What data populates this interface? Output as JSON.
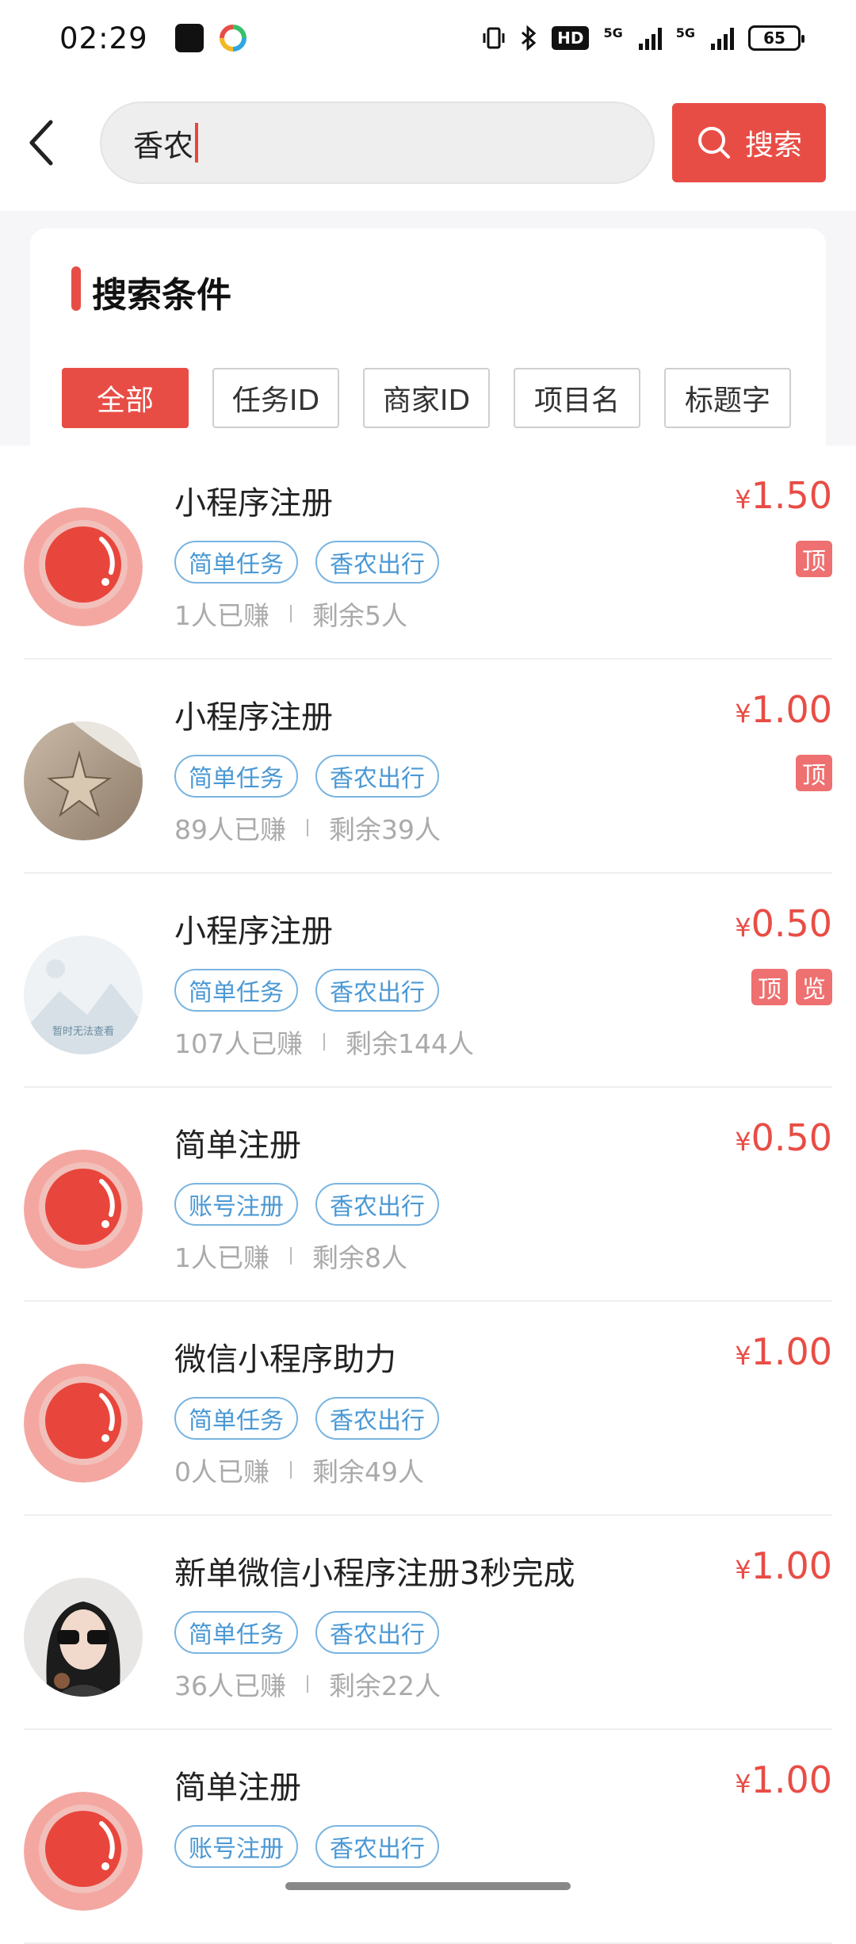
{
  "status": {
    "time": "02:29",
    "battery": "65",
    "net1": "5G",
    "net2": "5G",
    "hd": "HD"
  },
  "search": {
    "value": "香农",
    "button_label": "搜索"
  },
  "conditions": {
    "title": "搜索条件",
    "filters": [
      "全部",
      "任务ID",
      "商家ID",
      "项目名",
      "标题字"
    ],
    "active_index": 0
  },
  "colors": {
    "accent": "#e84d45",
    "tag_blue": "#4a98d4",
    "badge": "#ee7070"
  },
  "tasks": [
    {
      "title": "小程序注册",
      "tags": [
        "简单任务",
        "香农出行"
      ],
      "earned": "1人已赚",
      "remaining": "剩余5人",
      "price": "1.50",
      "currency": "¥",
      "badges": [
        "顶"
      ],
      "avatar": "red-camera-icon"
    },
    {
      "title": "小程序注册",
      "tags": [
        "简单任务",
        "香农出行"
      ],
      "earned": "89人已赚",
      "remaining": "剩余39人",
      "price": "1.00",
      "currency": "¥",
      "badges": [
        "顶"
      ],
      "avatar": "starfish-photo"
    },
    {
      "title": "小程序注册",
      "tags": [
        "简单任务",
        "香农出行"
      ],
      "earned": "107人已赚",
      "remaining": "剩余144人",
      "price": "0.50",
      "currency": "¥",
      "badges": [
        "顶",
        "览"
      ],
      "avatar": "image-unavailable",
      "avatar_text": "暂时无法查看"
    },
    {
      "title": "简单注册",
      "tags": [
        "账号注册",
        "香农出行"
      ],
      "earned": "1人已赚",
      "remaining": "剩余8人",
      "price": "0.50",
      "currency": "¥",
      "badges": [],
      "avatar": "red-camera-icon"
    },
    {
      "title": "微信小程序助力",
      "tags": [
        "简单任务",
        "香农出行"
      ],
      "earned": "0人已赚",
      "remaining": "剩余49人",
      "price": "1.00",
      "currency": "¥",
      "badges": [],
      "avatar": "red-camera-icon"
    },
    {
      "title": "新单微信小程序注册3秒完成",
      "tags": [
        "简单任务",
        "香农出行"
      ],
      "earned": "36人已赚",
      "remaining": "剩余22人",
      "price": "1.00",
      "currency": "¥",
      "badges": [],
      "avatar": "woman-sunglasses-photo"
    },
    {
      "title": "简单注册",
      "tags": [
        "账号注册",
        "香农出行"
      ],
      "earned": "",
      "remaining": "",
      "price": "1.00",
      "currency": "¥",
      "badges": [],
      "avatar": "red-camera-icon"
    }
  ]
}
